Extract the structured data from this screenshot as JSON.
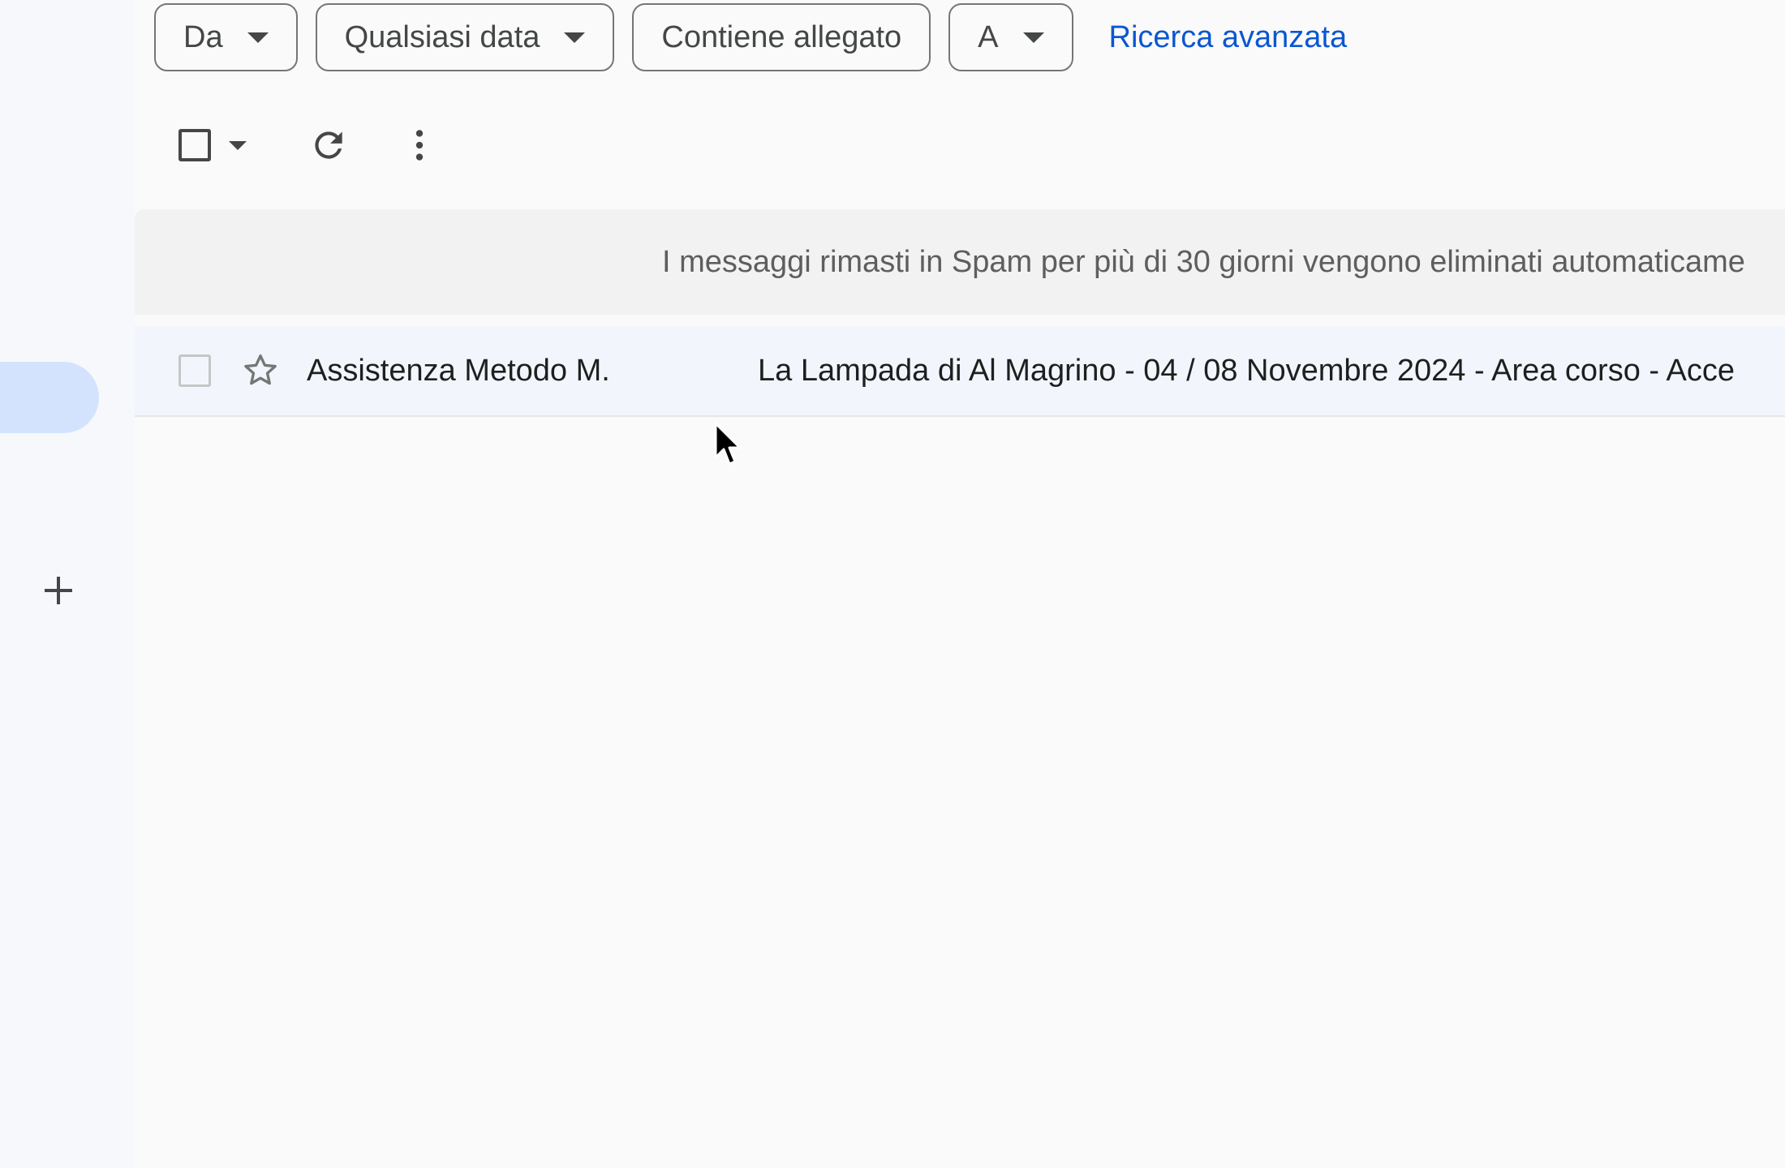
{
  "filters": {
    "from_label": "Da",
    "date_label": "Qualsiasi data",
    "attachment_label": "Contiene allegato",
    "to_label": "A",
    "advanced_search": "Ricerca avanzata"
  },
  "toolbar": {
    "select_all": "select-all-checkbox",
    "refresh_icon": "refresh-icon",
    "more_icon": "more-vert-icon"
  },
  "notice": {
    "text": "I messaggi rimasti in Spam per più di 30 giorni vengono eliminati automaticame"
  },
  "messages": [
    {
      "sender": "Assistenza Metodo M.",
      "subject": "La Lampada di Al Magrino - 04 / 08 Novembre 2024 - Area corso - Acce",
      "starred": false,
      "selected": false
    }
  ],
  "colors": {
    "accent_link": "#0b57d0",
    "active_nav": "#d3e3fd",
    "row_background": "#f2f6fc"
  }
}
